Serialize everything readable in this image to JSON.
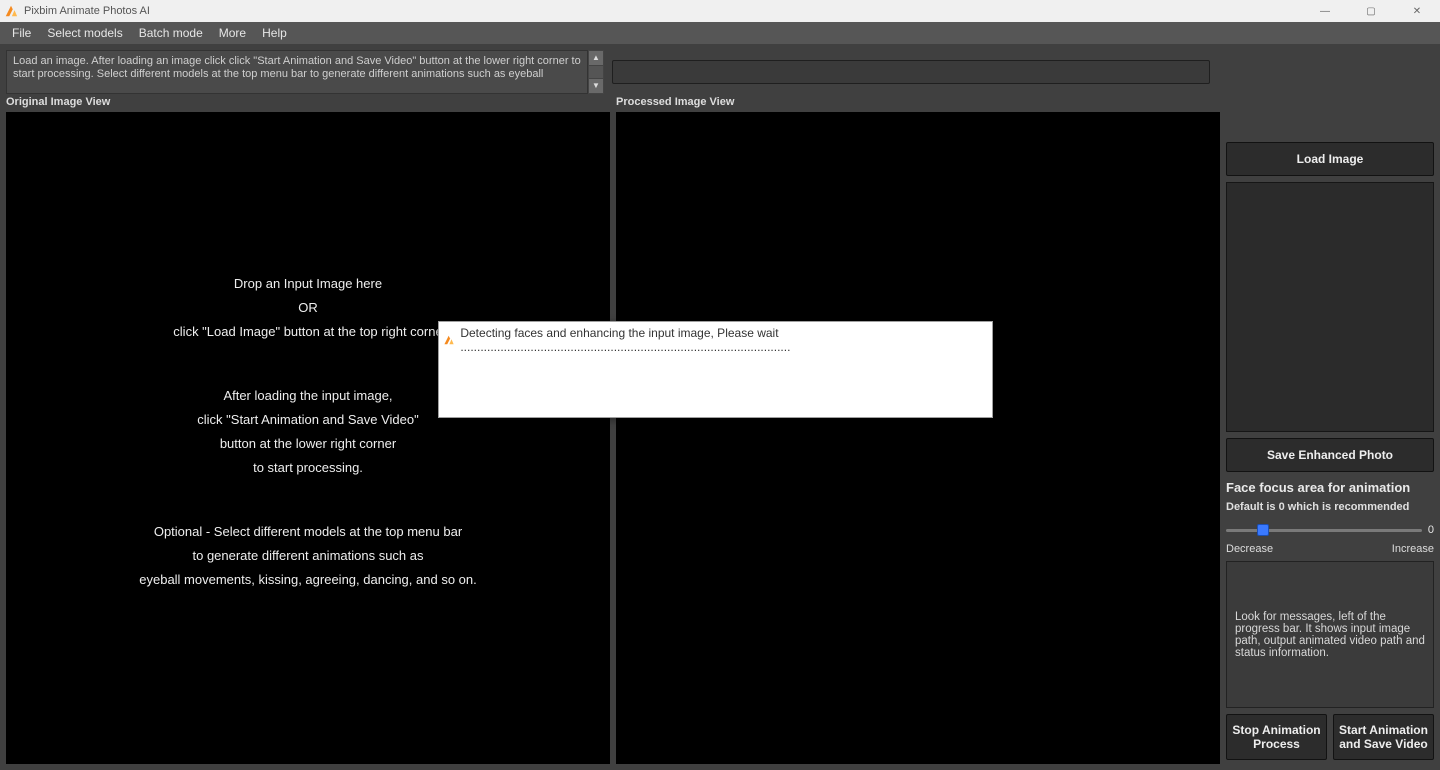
{
  "title": "Pixbim Animate Photos AI",
  "menu": [
    "File",
    "Select models",
    "Batch mode",
    "More",
    "Help"
  ],
  "info_text": "Load an image. After loading an image click click \"Start Animation and Save Video\" button at the lower right corner to start processing. Select different models at the top menu bar to generate different animations such as eyeball",
  "status_value": "",
  "views": {
    "original_label": "Original Image View",
    "processed_label": "Processed Image View"
  },
  "placeholder": {
    "l1": "Drop an Input Image here",
    "l2": "OR",
    "l3": "click \"Load Image\" button at the top right corne",
    "l4": "",
    "l5": "After loading the input image,",
    "l6": "click \"Start Animation and Save Video\"",
    "l7": "button at the lower right corner",
    "l8": "to start processing.",
    "l9": "",
    "l10": "Optional - Select different models at the top menu bar",
    "l11": "to generate different animations such as",
    "l12": "eyeball movements, kissing, agreeing, dancing, and so on."
  },
  "sidebar": {
    "load_image": "Load Image",
    "save_enhanced": "Save Enhanced Photo",
    "focus_title": "Face focus area for animation",
    "focus_sub": "Default is 0 which is recommended",
    "slider_value": "0",
    "slider_left": "Decrease",
    "slider_right": "Increase",
    "msg": "Look for messages, left of the progress bar. It shows input image path, output animated video path and status information.",
    "stop_btn": "Stop Animation\nProcess",
    "start_btn": "Start Animation\nand Save Video"
  },
  "modal": {
    "text": "Detecting faces and enhancing the input image, Please wait ..................................................................................................."
  },
  "window_controls": {
    "min": "—",
    "max": "▢",
    "close": "✕"
  }
}
